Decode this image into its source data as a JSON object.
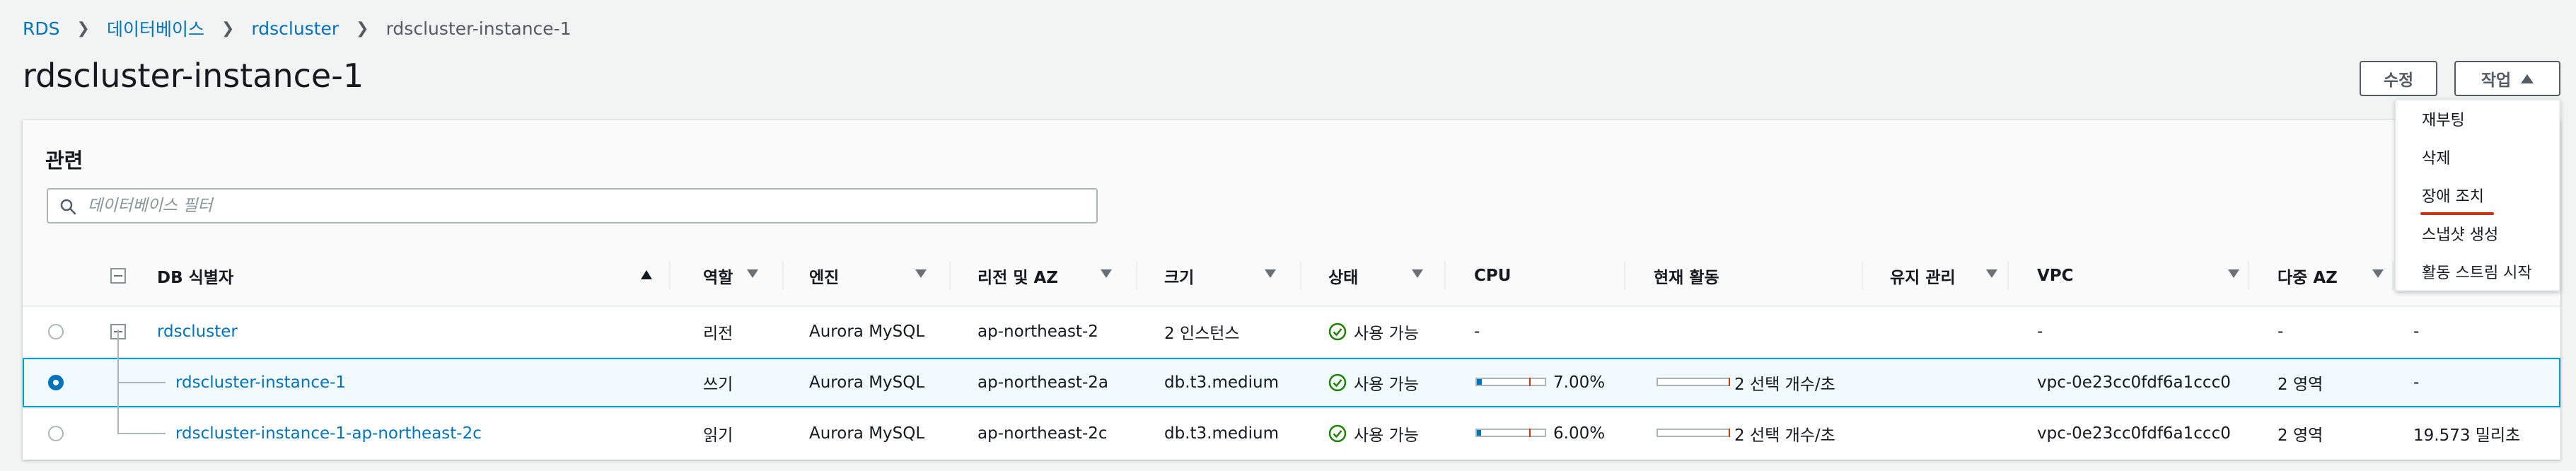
{
  "breadcrumb": {
    "rds": "RDS",
    "databases": "데이터베이스",
    "cluster": "rdscluster",
    "current": "rdscluster-instance-1"
  },
  "page_title": "rdscluster-instance-1",
  "buttons": {
    "edit": "수정",
    "actions": "작업"
  },
  "related": {
    "title": "관련",
    "filter_placeholder": "데이터베이스 필터",
    "columns": {
      "db_id": "DB 식별자",
      "role": "역할",
      "engine": "엔진",
      "region": "리전 및 AZ",
      "size": "크기",
      "status": "상태",
      "cpu": "CPU",
      "activity": "현재 활동",
      "maintenance": "유지 관리",
      "vpc": "VPC",
      "multi_az": "다중 AZ"
    },
    "rows": [
      {
        "id": "rdscluster",
        "role": "리전",
        "engine": "Aurora MySQL",
        "region": "ap-northeast-2",
        "size": "2 인스턴스",
        "status": "사용 가능",
        "cpu": "-",
        "activity": "",
        "maintenance": "",
        "vpc": "-",
        "multi_az": "-",
        "extra": "-",
        "selected": false
      },
      {
        "id": "rdscluster-instance-1",
        "role": "쓰기",
        "engine": "Aurora MySQL",
        "region": "ap-northeast-2a",
        "size": "db.t3.medium",
        "status": "사용 가능",
        "cpu": "7.00%",
        "cpu_value": 7.0,
        "activity": "2 선택 개수/초",
        "maintenance": "",
        "vpc": "vpc-0e23cc0fdf6a1ccc0",
        "multi_az": "2 영역",
        "extra": "-",
        "selected": true
      },
      {
        "id": "rdscluster-instance-1-ap-northeast-2c",
        "role": "읽기",
        "engine": "Aurora MySQL",
        "region": "ap-northeast-2c",
        "size": "db.t3.medium",
        "status": "사용 가능",
        "cpu": "6.00%",
        "cpu_value": 6.0,
        "activity": "2 선택 개수/초",
        "maintenance": "",
        "vpc": "vpc-0e23cc0fdf6a1ccc0",
        "multi_az": "2 영역",
        "extra": "19.573 밀리초",
        "selected": false
      }
    ]
  },
  "actions_menu": [
    "재부팅",
    "삭제",
    "장애 조치",
    "스냅샷 생성",
    "활동 스트림 시작"
  ],
  "colors": {
    "link": "#0073bb",
    "success": "#1d8102",
    "border": "#eaeded",
    "danger": "#d13212"
  }
}
